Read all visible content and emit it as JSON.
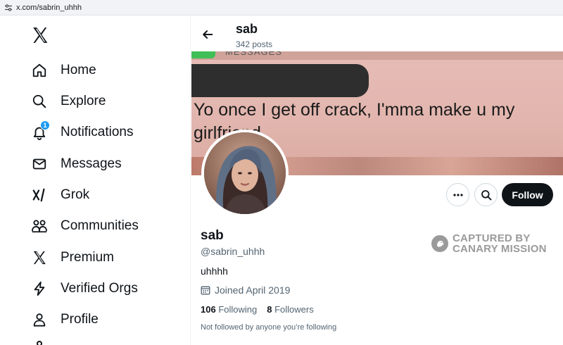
{
  "browser": {
    "url": "x.com/sabrin_uhhh"
  },
  "sidebar": {
    "items": [
      {
        "label": "Home",
        "icon": "home-icon"
      },
      {
        "label": "Explore",
        "icon": "search-icon"
      },
      {
        "label": "Notifications",
        "icon": "bell-icon",
        "badge": "1"
      },
      {
        "label": "Messages",
        "icon": "envelope-icon"
      },
      {
        "label": "Grok",
        "icon": "grok-icon"
      },
      {
        "label": "Communities",
        "icon": "people-icon"
      },
      {
        "label": "Premium",
        "icon": "x-logo-icon"
      },
      {
        "label": "Verified Orgs",
        "icon": "lightning-icon"
      },
      {
        "label": "Profile",
        "icon": "person-icon"
      }
    ]
  },
  "header": {
    "name": "sab",
    "posts": "342 posts"
  },
  "banner": {
    "title_fragment": "MESSAGES",
    "message": "Yo once I get off crack, I'mma make u my girlfriend."
  },
  "actions": {
    "follow_label": "Follow"
  },
  "profile": {
    "name": "sab",
    "handle": "@sabrin_uhhh",
    "bio": "uhhhh",
    "joined": "Joined April 2019",
    "following_count": "106",
    "following_label": "Following",
    "followers_count": "8",
    "followers_label": "Followers",
    "followed_by_note": "Not followed by anyone you’re following"
  },
  "watermark": {
    "line1": "CAPTURED BY",
    "line2": "CANARY MISSION"
  },
  "colors": {
    "accent": "#1d9bf0",
    "text": "#0f1419",
    "secondary_text": "#536471",
    "follow_button": "#0f1419"
  }
}
